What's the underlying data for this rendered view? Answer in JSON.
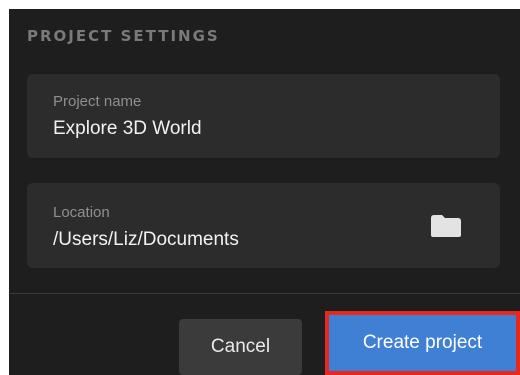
{
  "section": {
    "title": "PROJECT SETTINGS"
  },
  "project_name": {
    "label": "Project name",
    "value": "Explore 3D World"
  },
  "location": {
    "label": "Location",
    "value": "/Users/Liz/Documents",
    "browse_icon": "folder-icon"
  },
  "actions": {
    "cancel_label": "Cancel",
    "create_label": "Create project"
  },
  "colors": {
    "panel_background": "#1e1e1e",
    "field_background": "#2c2c2c",
    "primary_button": "#3f7fd4",
    "highlight_border": "#e5291e",
    "secondary_button": "#3b3b3b"
  }
}
